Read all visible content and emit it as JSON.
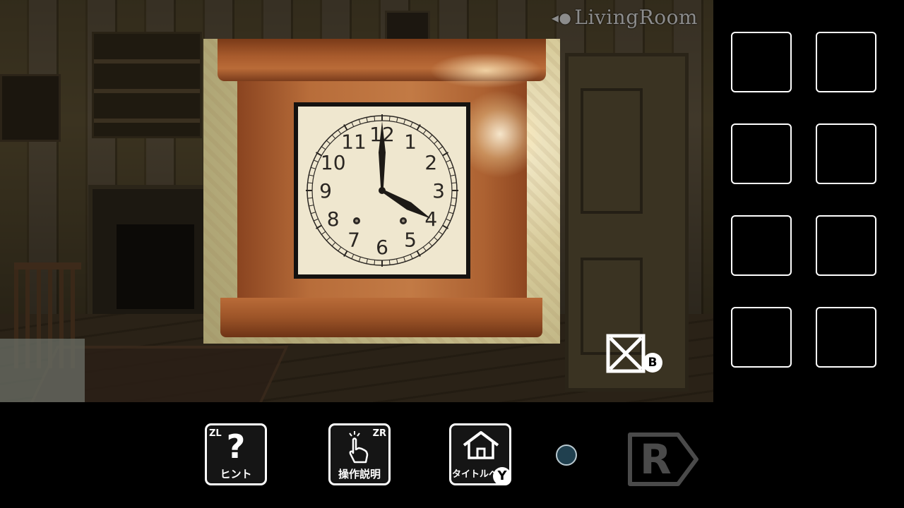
{
  "scene": {
    "room_label": "LivingRoom"
  },
  "clock": {
    "numerals": [
      "12",
      "1",
      "2",
      "3",
      "4",
      "5",
      "6",
      "7",
      "8",
      "9",
      "10",
      "11"
    ],
    "hour": 4,
    "minute": 0
  },
  "close_button": {
    "badge": "B",
    "icon": "close-x-icon"
  },
  "inventory": {
    "slot_count": 8
  },
  "toolbar": {
    "hint": {
      "label": "ヒント",
      "corner": "ZL",
      "icon": "question-mark-icon"
    },
    "controls": {
      "label": "操作説明",
      "corner": "ZR",
      "icon": "tap-hand-icon"
    },
    "title": {
      "label": "タイトルへ",
      "badge": "Y",
      "icon": "house-icon"
    },
    "page_indicator": {
      "icon": "page-dot-icon",
      "color": "#20404f"
    },
    "next": {
      "letter": "R",
      "icon": "next-arrow-icon"
    }
  }
}
